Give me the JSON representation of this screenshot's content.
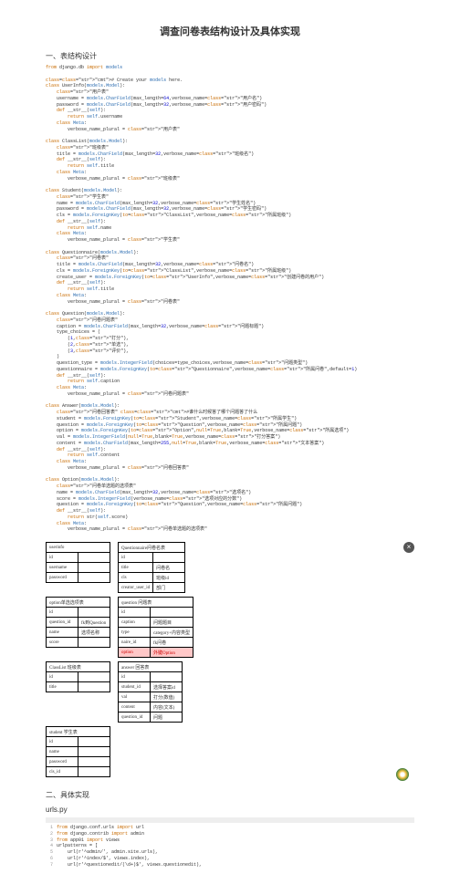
{
  "title": "调查问卷表结构设计及具体实现",
  "section1": "一、表结构设计",
  "section2": "二、具体实现",
  "urlspy": "urls.py",
  "comment1": "# Create your models here.",
  "code_lines": [
    "from django.db import models",
    "",
    "# Create your models here.",
    "class UserInfo(models.Model):",
    "    \"用户表\"",
    "    username = models.CharField(max_length=64,verbose_name=\"用户名\")",
    "    password = models.CharField(max_length=32,verbose_name=\"用户密码\")",
    "    def __str__(self):",
    "        return self.username",
    "    class Meta:",
    "        verbose_name_plural = \"用户表\"",
    "",
    "class ClassList(models.Model):",
    "    \"班级表\"",
    "    title = models.CharField(max_length=32,verbose_name=\"班级名\")",
    "    def __str__(self):",
    "        return self.title",
    "    class Meta:",
    "        verbose_name_plural = \"班级表\"",
    "",
    "class Student(models.Model):",
    "    \"学生表\"",
    "    name = models.CharField(max_length=32,verbose_name=\"学生姓名\")",
    "    password = models.CharField(max_length=32,verbose_name=\"学生密码\")",
    "    cls = models.ForeignKey(to=\"ClassList\",verbose_name=\"所属班级\")",
    "    def __str__(self):",
    "        return self.name",
    "    class Meta:",
    "        verbose_name_plural = \"学生表\"",
    "",
    "class Questionnaire(models.Model):",
    "    \"问卷表\"",
    "    title = models.CharField(max_length=32,verbose_name=\"问卷名\")",
    "    cls = models.ForeignKey(to=\"ClassList\",verbose_name=\"所属班级\")",
    "    create_user = models.ForeignKey(to=\"UserInfo\",verbose_name=\"创建问卷的用户\")",
    "    def __str__(self):",
    "        return self.title",
    "    class Meta:",
    "        verbose_name_plural = \"问卷表\"",
    "",
    "class Question(models.Model):",
    "    \"问卷问题表\"",
    "    caption = models.CharField(max_length=32,verbose_name=\"问题标题\")",
    "    type_choices = (",
    "        (1,\"打分\"),",
    "        (2,\"单选\"),",
    "        (3,\"评价\"),",
    "    )",
    "    question_type = models.IntegerField(choices=type_choices,verbose_name=\"问题类型\")",
    "    questionnaire = models.ForeignKey(to=\"Questionnaire\",verbose_name=\"所属问卷\",default=1)",
    "    def __str__(self):",
    "        return self.caption",
    "    class Meta:",
    "        verbose_name_plural = \"问卷问题表\"",
    "",
    "class Answer(models.Model):",
    "    \"问卷回答表\" #谁什么时候答了哪个问题答了什么",
    "    student = models.ForeignKey(to=\"Student\",verbose_name=\"所属学生\")",
    "    question = models.ForeignKey(to=\"Question\",verbose_name=\"所属问题\")",
    "    option = models.ForeignKey(to=\"Option\",null=True,blank=True,verbose_name=\"所属选项\")",
    "    val = models.IntegerField(null=True,blank=True,verbose_name=\"打分答案\")",
    "    content = models.CharField(max_length=255,null=True,blank=True,verbose_name=\"文本答案\")",
    "    def __str__(self):",
    "        return self.content",
    "    class Meta:",
    "        verbose_name_plural = \"问卷回答表\"",
    "",
    "class Option(models.Model):",
    "    \"问卷单选题的选项表\"",
    "    name = models.CharField(max_length=32,verbose_name=\"选项名\")",
    "    score = models.IntegerField(verbose_name=\"选项对应的分数\")",
    "    question = models.ForeignKey(to=\"Question\",verbose_name=\"所属问题\")",
    "    def __str__(self):",
    "        return str(self.score)",
    "    class Meta:",
    "        verbose_name_plural = \"问卷单选题的选项表\""
  ],
  "tables": {
    "userinfo": {
      "title": "userinfo",
      "rows": [
        [
          "id",
          ""
        ],
        [
          "username",
          ""
        ],
        [
          "password",
          ""
        ]
      ]
    },
    "questionnaire": {
      "title": "Questionnaire问卷名表",
      "rows": [
        [
          "id",
          ""
        ],
        [
          "title",
          "问卷名"
        ],
        [
          "cls",
          "班级id"
        ],
        [
          "creator_user_id",
          "部门"
        ]
      ]
    },
    "option": {
      "title": "option单选选项表",
      "rows": [
        [
          "id",
          ""
        ],
        [
          "question_id",
          "fk到Question"
        ],
        [
          "name",
          "选项名称"
        ],
        [
          "score",
          ""
        ]
      ]
    },
    "question": {
      "title": "question 问题表",
      "rows": [
        [
          "id",
          ""
        ],
        [
          "caption",
          "问题题目"
        ],
        [
          "type",
          "category+内容类型"
        ],
        [
          "naire_id",
          "fk问卷"
        ]
      ],
      "hl": [
        "option",
        "外键Option"
      ]
    },
    "classlist": {
      "title": "ClassList 班级表",
      "rows": [
        [
          "id",
          ""
        ],
        [
          "title",
          ""
        ]
      ]
    },
    "answer": {
      "title": "answer 回答表",
      "rows": [
        [
          "id",
          ""
        ],
        [
          "student_id",
          "选择答案id"
        ],
        [
          "val",
          "打分(数值)"
        ],
        [
          "content",
          "内容(文本)"
        ],
        [
          "question_id",
          "问题"
        ]
      ]
    },
    "student": {
      "title": "student 学生表",
      "rows": [
        [
          "id",
          ""
        ],
        [
          "name",
          ""
        ],
        [
          "password",
          ""
        ],
        [
          "cls_id",
          ""
        ]
      ]
    }
  },
  "urls_code": [
    "from django.conf.urls import url",
    "from django.contrib import admin",
    "from app01 import views",
    "urlpatterns = [",
    "    url(r'^admin/', admin.site.urls),",
    "    url(r'^index/$', views.index),",
    "    url(r'^questionedit/(\\d+)$', views.questionedit),"
  ]
}
